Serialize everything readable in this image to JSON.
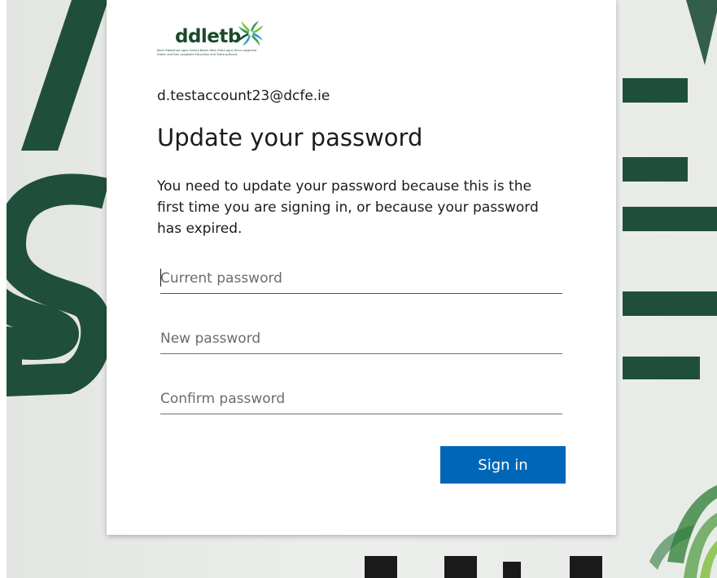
{
  "logo": {
    "name": "ddletb",
    "tagline_line1": "Bord Oideachais agus Oiliúna Bhaile Átha Cliath agus Dhún Laoghaire",
    "tagline_line2": "Dublin and Dún Laoghaire Education and Training Board",
    "colors": [
      "#1a4a2b",
      "#3a9a4e",
      "#7dbd3b",
      "#2aa3c8"
    ]
  },
  "account": {
    "email": "d.testaccount23@dcfe.ie"
  },
  "heading": "Update your password",
  "description": "You need to update your password because this is the first time you are signing in, or because your password has expired.",
  "fields": {
    "current_password_placeholder": "Current password",
    "new_password_placeholder": "New password",
    "confirm_password_placeholder": "Confirm password"
  },
  "buttons": {
    "sign_in": "Sign in"
  },
  "colors": {
    "accent": "#0067b8",
    "background_letters": "#1f4f3a",
    "card": "#ffffff"
  },
  "icons": {
    "logo_mark": "swirl-logo-icon",
    "background_mark": "leaf-swirl-icon"
  }
}
